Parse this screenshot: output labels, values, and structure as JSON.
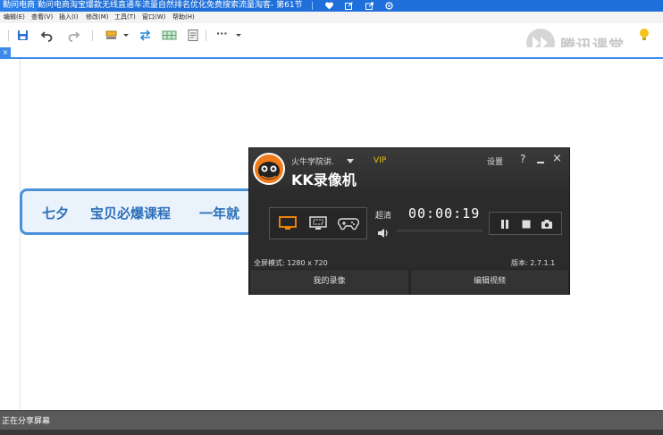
{
  "titlebar": {
    "app_name": "勤问电商",
    "doc_title": "勤问电商淘宝爆款无线直通车流量自然排名优化免费搜索流量淘客- 第61节"
  },
  "menu": {
    "items": [
      "编辑(E)",
      "查看(V)",
      "插入(I)",
      "修改(M)",
      "工具(T)",
      "窗口(W)",
      "帮助(H)"
    ]
  },
  "toolbar": {
    "more_label": "···"
  },
  "brand": {
    "name": "腾讯课堂"
  },
  "tab": {
    "close_glyph": "×"
  },
  "banner": {
    "part1": "七夕",
    "part2": "宝贝必爆课程",
    "part3": "一年就"
  },
  "recorder": {
    "user_label": "火牛学院讲.",
    "vip": "VIP",
    "title": "KK录像机",
    "settings": "设置",
    "help": "?",
    "close": "×",
    "quality": "超清",
    "timer": "00:00:19",
    "mode_text": "全屏模式: 1280 x 720",
    "version": "版本: 2.7.1.1",
    "my_recordings": "我的录像",
    "edit_video": "编辑视频"
  },
  "share": {
    "status": "正在分享屏幕"
  },
  "colors": {
    "titlebar": "#1e6fd9",
    "accent_blue": "#3d8be8",
    "recorder_bg": "#2b2b2b",
    "vip": "#e8c000",
    "mode_orange": "#ff8a00"
  }
}
